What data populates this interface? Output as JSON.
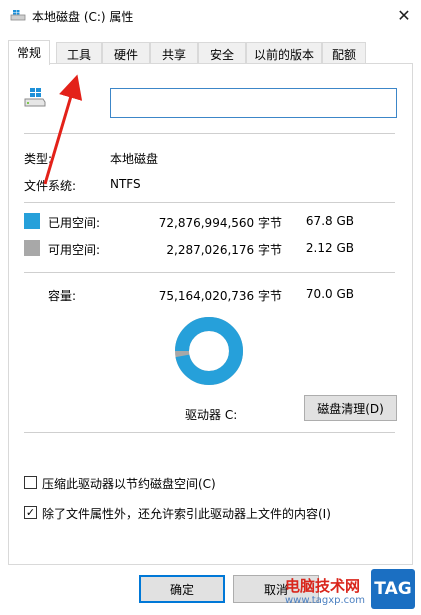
{
  "window": {
    "title": "本地磁盘 (C:) 属性",
    "close_glyph": "✕"
  },
  "tabs": [
    {
      "label": "常规",
      "active": true
    },
    {
      "label": "工具",
      "active": false
    },
    {
      "label": "硬件",
      "active": false
    },
    {
      "label": "共享",
      "active": false
    },
    {
      "label": "安全",
      "active": false
    },
    {
      "label": "以前的版本",
      "active": false
    },
    {
      "label": "配额",
      "active": false
    }
  ],
  "general": {
    "drive_name_value": "",
    "type_label": "类型:",
    "type_value": "本地磁盘",
    "fs_label": "文件系统:",
    "fs_value": "NTFS",
    "used_label": "已用空间:",
    "used_bytes": "72,876,994,560 字节",
    "used_gb": "67.8 GB",
    "free_label": "可用空间:",
    "free_bytes": "2,287,026,176 字节",
    "free_gb": "2.12 GB",
    "capacity_label": "容量:",
    "capacity_bytes": "75,164,020,736 字节",
    "capacity_gb": "70.0 GB",
    "drive_label": "驱动器 C:",
    "cleanup_button": "磁盘清理(D)",
    "compress_label": "压缩此驱动器以节约磁盘空间(C)",
    "compress_checked": false,
    "index_label": "除了文件属性外，还允许索引此驱动器上文件的内容(I)",
    "index_checked": true
  },
  "usage": {
    "used_fraction": 0.9696,
    "used_color": "#26a0da",
    "free_color": "#a8a8a8"
  },
  "buttons": {
    "ok": "确定",
    "cancel": "取消"
  },
  "watermark": {
    "site_name": "电脑技术网",
    "site_url": "www.tagxp.com",
    "badge": "TAG"
  },
  "icons": {
    "title_icon": "drive-icon",
    "close_icon": "close-icon",
    "drive_icon": "windows-drive-icon",
    "annotation": "red-arrow"
  }
}
